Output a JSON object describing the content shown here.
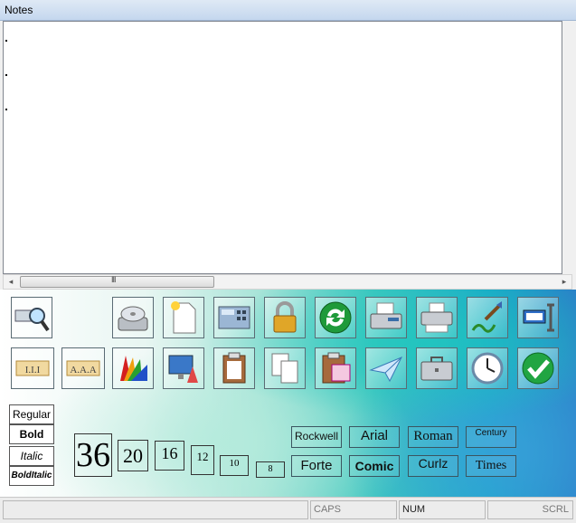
{
  "window": {
    "title": "Notes"
  },
  "scrollbar": {
    "left_arrow": "◂",
    "right_arrow": "▸",
    "thumb_grip": "III"
  },
  "toolbar_row1": [
    {
      "name": "find-icon"
    },
    {
      "name": "disk-drive-icon"
    },
    {
      "name": "new-document-icon"
    },
    {
      "name": "calculator-icon"
    },
    {
      "name": "padlock-icon"
    },
    {
      "name": "refresh-icon"
    },
    {
      "name": "fax-icon"
    },
    {
      "name": "fax-print-icon"
    },
    {
      "name": "signature-icon"
    },
    {
      "name": "text-cursor-icon"
    }
  ],
  "toolbar_row2": [
    {
      "name": "align-left-icon"
    },
    {
      "name": "align-right-icon"
    },
    {
      "name": "color-palette-icon"
    },
    {
      "name": "display-settings-icon"
    },
    {
      "name": "paste-icon"
    },
    {
      "name": "copy-icon"
    },
    {
      "name": "cut-icon"
    },
    {
      "name": "send-icon"
    },
    {
      "name": "briefcase-icon"
    },
    {
      "name": "clock-icon"
    },
    {
      "name": "checkmark-icon"
    }
  ],
  "font_styles": [
    "Regular",
    "Bold",
    "Italic",
    "BoldItalic"
  ],
  "font_sizes": [
    "36",
    "20",
    "16",
    "12",
    "10",
    "8"
  ],
  "font_names_row1": [
    "Rockwell",
    "Arial",
    "Roman",
    "Century"
  ],
  "font_names_row2": [
    "Forte",
    "Comic",
    "Curlz",
    "Times"
  ],
  "status": {
    "caps": "CAPS",
    "num": "NUM",
    "scrl": "SCRL"
  },
  "colors": {
    "accent_teal": "#3fc7bf",
    "accent_blue": "#2a80c8"
  }
}
